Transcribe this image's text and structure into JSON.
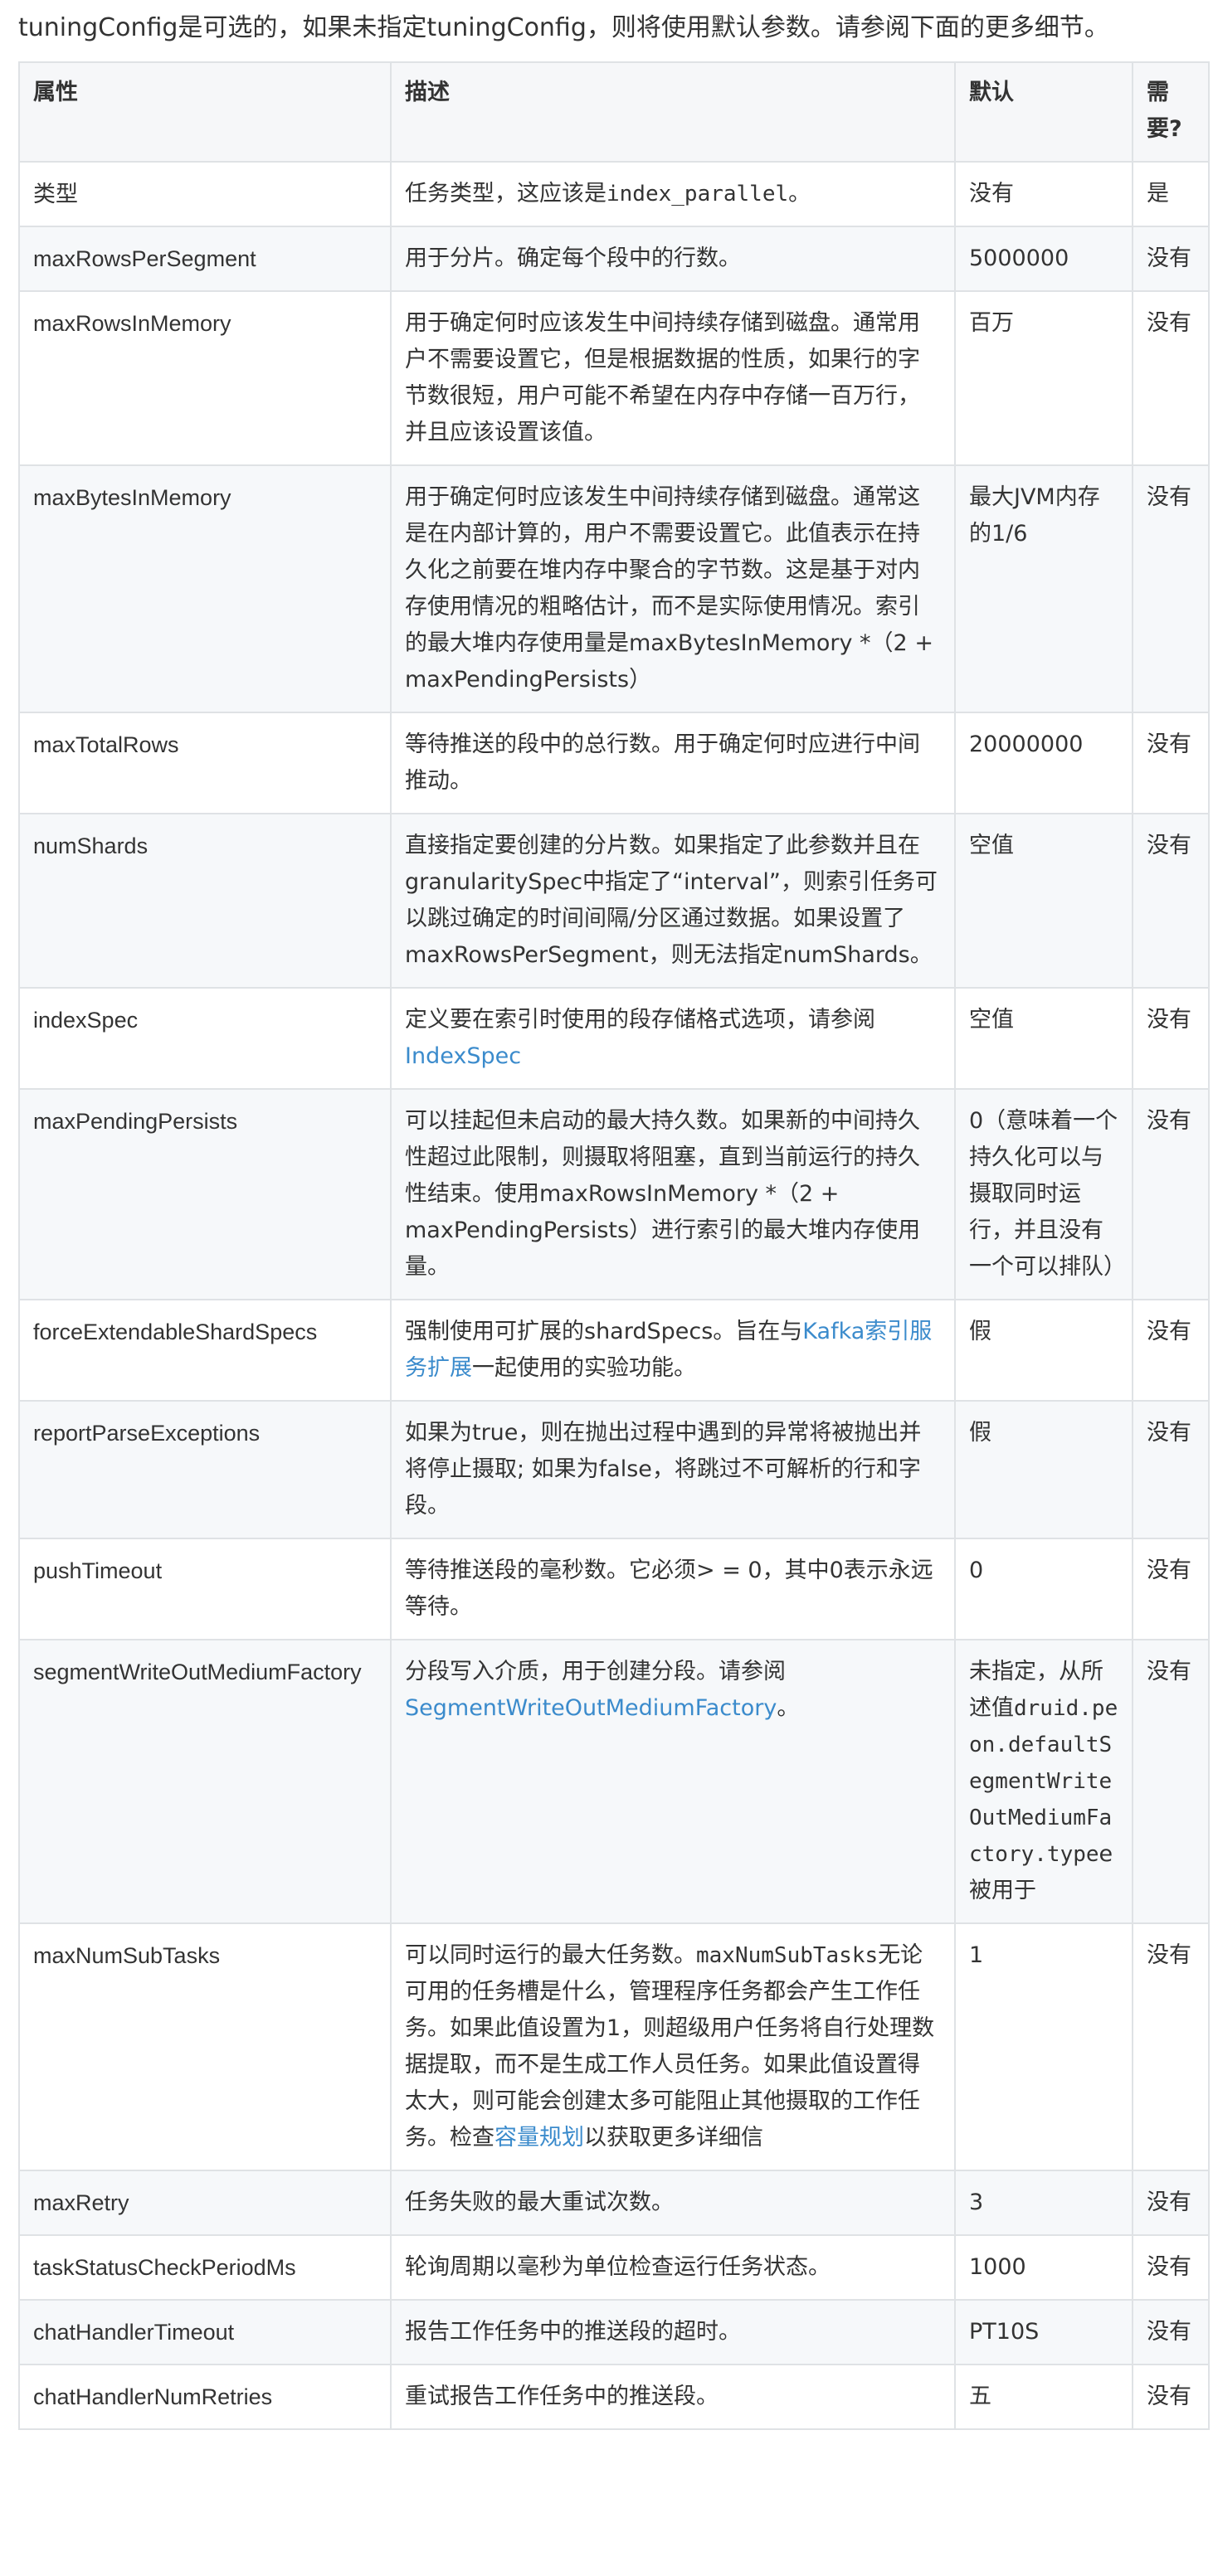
{
  "intro": "tuningConfig是可选的，如果未指定tuningConfig，则将使用默认参数。请参阅下面的更多细节。",
  "headers": {
    "property": "属性",
    "description": "描述",
    "default": "默认",
    "required": "需要?"
  },
  "rows": [
    {
      "name": "类型",
      "desc_a": "任务类型，这应该是",
      "desc_code": "index_parallel",
      "desc_b": "。",
      "default": "没有",
      "required": "是"
    },
    {
      "name": "maxRowsPerSegment",
      "desc": "用于分片。确定每个段中的行数。",
      "default": "5000000",
      "required": "没有"
    },
    {
      "name": "maxRowsInMemory",
      "desc": "用于确定何时应该发生中间持续存储到磁盘。通常用户不需要设置它，但是根据数据的性质，如果行的字节数很短，用户可能不希望在内存中存储一百万行，并且应该设置该值。",
      "default": "百万",
      "required": "没有"
    },
    {
      "name": "maxBytesInMemory",
      "desc": "用于确定何时应该发生中间持续存储到磁盘。通常这是在内部计算的，用户不需要设置它。此值表示在持久化之前要在堆内存中聚合的字节数。这是基于对内存使用情况的粗略估计，而不是实际使用情况。索引的最大堆内存使用量是maxBytesInMemory *（2 + maxPendingPersists）",
      "default": "最大JVM内存的1/6",
      "required": "没有"
    },
    {
      "name": "maxTotalRows",
      "desc": "等待推送的段中的总行数。用于确定何时应进行中间推动。",
      "default": "20000000",
      "required": "没有"
    },
    {
      "name": "numShards",
      "desc": "直接指定要创建的分片数。如果指定了此参数并且在granularitySpec中指定了“interval”，则索引任务可以跳过确定的时间间隔/分区通过数据。如果设置了maxRowsPerSegment，则无法指定numShards。",
      "default": "空值",
      "required": "没有"
    },
    {
      "name": "indexSpec",
      "desc_a": "定义要在索引时使用的段存储格式选项，请参阅",
      "desc_link": "IndexSpec",
      "desc_b": "",
      "default": "空值",
      "required": "没有"
    },
    {
      "name": "maxPendingPersists",
      "desc": "可以挂起但未启动的最大持久数。如果新的中间持久性超过此限制，则摄取将阻塞，直到当前运行的持久性结束。使用maxRowsInMemory *（2 + maxPendingPersists）进行索引的最大堆内存使用量。",
      "default": "0（意味着一个持久化可以与摄取同时运行，并且没有一个可以排队）",
      "required": "没有"
    },
    {
      "name": "forceExtendableShardSpecs",
      "desc_a": "强制使用可扩展的shardSpecs。旨在与",
      "desc_link": "Kafka索引服务扩展",
      "desc_b": "一起使用的实验功能。",
      "default": "假",
      "required": "没有"
    },
    {
      "name": "reportParseExceptions",
      "desc": "如果为true，则在抛出过程中遇到的异常将被抛出并将停止摄取; 如果为false，将跳过不可解析的行和字段。",
      "default": "假",
      "required": "没有"
    },
    {
      "name": "pushTimeout",
      "desc": "等待推送段的毫秒数。它必须> = 0，其中0表示永远等待。",
      "default": "0",
      "required": "没有"
    },
    {
      "name": "segmentWriteOutMediumFactory",
      "desc_a": "分段写入介质，用于创建分段。请参阅",
      "desc_link": "SegmentWriteOutMediumFactory",
      "desc_b": "。",
      "default_a": "未指定，从所述值",
      "default_code": "druid.peon.defaultSegmentWriteOutMediumFactory.type",
      "default_b": "e被用于",
      "required": "没有"
    },
    {
      "name": "maxNumSubTasks",
      "desc_code": "maxNumSubTasks",
      "desc_pre": "可以同时运行的最大任务数。",
      "desc_mid": "无论可用的任务槽是什么，管理程序任务都会产生工作任务。如果此值设置为1，则超级用户任务将自行处理数据提取，而不是生成工作人员任务。如果此值设置得太大，则可能会创建太多可能阻止其他摄取的工作任务。检查",
      "desc_link": "容量规划",
      "desc_post": "以获取更多详细信",
      "default": "1",
      "required": "没有"
    },
    {
      "name": "maxRetry",
      "desc": "任务失败的最大重试次数。",
      "default": "3",
      "required": "没有"
    },
    {
      "name": "taskStatusCheckPeriodMs",
      "desc": "轮询周期以毫秒为单位检查运行任务状态。",
      "default": "1000",
      "required": "没有"
    },
    {
      "name": "chatHandlerTimeout",
      "desc": "报告工作任务中的推送段的超时。",
      "default": "PT10S",
      "required": "没有"
    },
    {
      "name": "chatHandlerNumRetries",
      "desc": "重试报告工作任务中的推送段。",
      "default": "五",
      "required": "没有"
    }
  ]
}
